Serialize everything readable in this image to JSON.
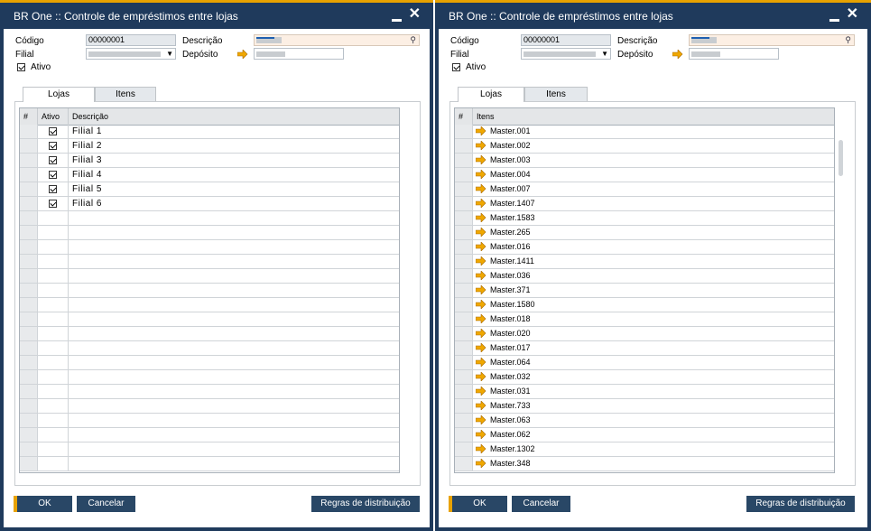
{
  "left": {
    "title": "BR One :: Controle de empréstimos entre lojas",
    "fields": {
      "codigo_label": "Código",
      "codigo_value": "00000001",
      "descricao_label": "Descrição",
      "filial_label": "Filial",
      "deposito_label": "Depósito",
      "ativo_label": "Ativo"
    },
    "tabs": [
      "Lojas",
      "Itens"
    ],
    "active_tab": "Lojas",
    "grid": {
      "headers": [
        "#",
        "Ativo",
        "Descrição"
      ],
      "rows": [
        {
          "checked": true,
          "descricao": "Filial 1"
        },
        {
          "checked": true,
          "descricao": "Filial 2"
        },
        {
          "checked": true,
          "descricao": "Filial 3"
        },
        {
          "checked": true,
          "descricao": "Filial 4"
        },
        {
          "checked": true,
          "descricao": "Filial 5"
        },
        {
          "checked": true,
          "descricao": "Filial 6"
        }
      ]
    },
    "buttons": {
      "ok": "OK",
      "cancelar": "Cancelar",
      "regras": "Regras de distribuição"
    }
  },
  "right": {
    "title": "BR One :: Controle de empréstimos entre lojas",
    "fields": {
      "codigo_label": "Código",
      "codigo_value": "00000001",
      "descricao_label": "Descrição",
      "filial_label": "Filial",
      "deposito_label": "Depósito",
      "ativo_label": "Ativo"
    },
    "tabs": [
      "Lojas",
      "Itens"
    ],
    "active_tab": "Lojas",
    "grid": {
      "headers": [
        "#",
        "Itens"
      ],
      "rows": [
        "Master.001",
        "Master.002",
        "Master.003",
        "Master.004",
        "Master.007",
        "Master.1407",
        "Master.1583",
        "Master.265",
        "Master.016",
        "Master.1411",
        "Master.036",
        "Master.371",
        "Master.1580",
        "Master.018",
        "Master.020",
        "Master.017",
        "Master.064",
        "Master.032",
        "Master.031",
        "Master.733",
        "Master.063",
        "Master.062",
        "Master.1302",
        "Master.348"
      ]
    },
    "buttons": {
      "ok": "OK",
      "cancelar": "Cancelar",
      "regras": "Regras de distribuição"
    }
  },
  "colors": {
    "window_bg": "#1f3a5c",
    "accent": "#e8a200",
    "button_bg": "#294766",
    "link_arrow": "#f0a800"
  }
}
